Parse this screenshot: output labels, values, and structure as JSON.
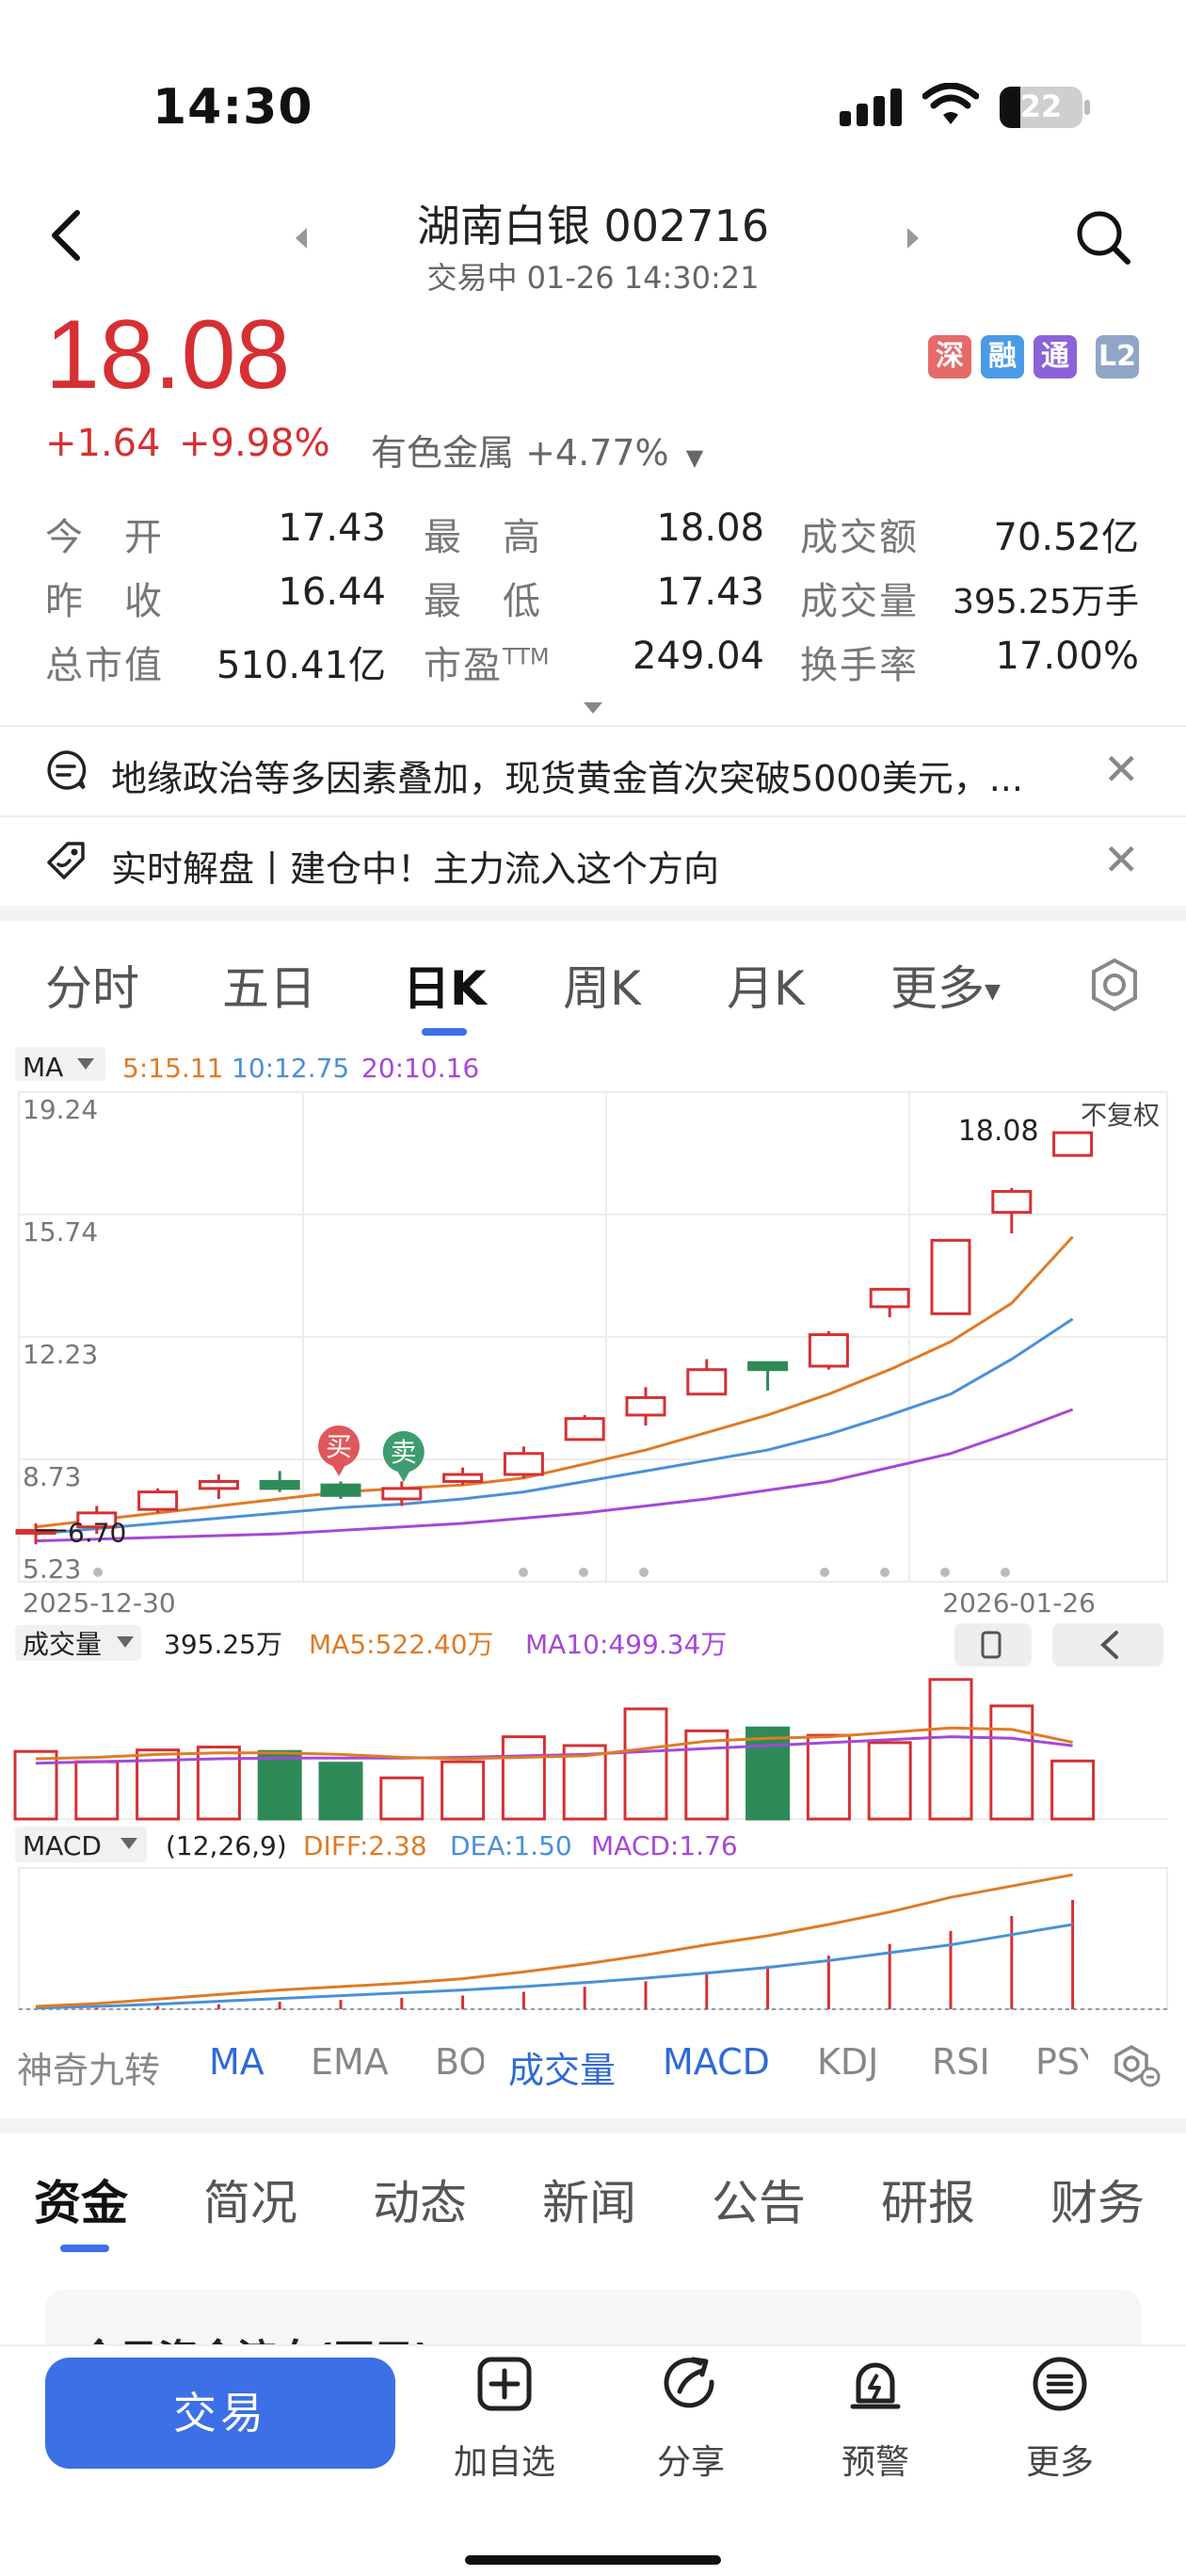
{
  "status": {
    "time": "14:30",
    "battery": "22"
  },
  "header": {
    "title": "湖南白银 002716",
    "subtitle": "交易中 01-26 14:30:21"
  },
  "price": {
    "current": "18.08",
    "change": "+1.64",
    "change_pct": "+9.98%",
    "sector": "有色金属 +4.77%"
  },
  "badges": [
    {
      "label": "深",
      "color": "#e66a6a"
    },
    {
      "label": "融",
      "color": "#4a9be6"
    },
    {
      "label": "通",
      "color": "#8a63d9"
    },
    {
      "label": "L2",
      "color": "#8fa6c7"
    }
  ],
  "stats": {
    "open_label": "今　开",
    "open": "17.43",
    "high_label": "最　高",
    "high": "18.08",
    "amount_label": "成交额",
    "amount": "70.52亿",
    "prev_label": "昨　收",
    "prev": "16.44",
    "low_label": "最　低",
    "low": "17.43",
    "volume_label": "成交量",
    "volume": "395.25万手",
    "mcap_label": "总市值",
    "mcap": "510.41亿",
    "pe_label": "市盈",
    "pe_sup": "TTM",
    "pe": "249.04",
    "turnover_label": "换手率",
    "turnover": "17.00%"
  },
  "news": [
    {
      "text": "地缘政治等多因素叠加，现货黄金首次突破5000美元，..."
    },
    {
      "text": "实时解盘丨建仓中！主力流入这个方向"
    }
  ],
  "chart_tabs": [
    "分时",
    "五日",
    "日K",
    "周K",
    "月K",
    "更多"
  ],
  "chart_tab_active": "日K",
  "ma_legend": {
    "label": "MA",
    "ma5": "5:15.11",
    "ma10": "10:12.75",
    "ma20": "20:10.16"
  },
  "price_axis": [
    "19.24",
    "15.74",
    "12.23",
    "8.73",
    "5.23"
  ],
  "price_axis_values": [
    19.24,
    15.74,
    12.23,
    8.73,
    5.23
  ],
  "date_axis": {
    "start": "2025-12-30",
    "end": "2026-01-26"
  },
  "high_label": "18.08",
  "low_label": "6.70",
  "no_adjust_label": "不复权",
  "buy_label": "买",
  "sell_label": "卖",
  "volume_legend": {
    "label": "成交量",
    "value": "395.25万",
    "ma5": "MA5:522.40万",
    "ma10": "MA10:499.34万"
  },
  "macd_legend": {
    "label": "MACD",
    "params": "(12,26,9)",
    "diff": "DIFF:2.38",
    "dea": "DEA:1.50",
    "macd": "MACD:1.76"
  },
  "chart_data": {
    "type": "candlestick",
    "ylim": [
      5.23,
      19.24
    ],
    "candles": [
      {
        "o": 6.7,
        "c": 6.7,
        "h": 6.9,
        "l": 6.3
      },
      {
        "o": 6.8,
        "c": 7.2,
        "h": 7.4,
        "l": 6.6
      },
      {
        "o": 7.3,
        "c": 7.8,
        "h": 7.9,
        "l": 7.2
      },
      {
        "o": 7.9,
        "c": 8.1,
        "h": 8.3,
        "l": 7.6
      },
      {
        "o": 8.1,
        "c": 7.9,
        "h": 8.4,
        "l": 7.8
      },
      {
        "o": 8.0,
        "c": 7.7,
        "h": 8.1,
        "l": 7.6
      },
      {
        "o": 7.6,
        "c": 7.9,
        "h": 8.1,
        "l": 7.4
      },
      {
        "o": 8.1,
        "c": 8.3,
        "h": 8.5,
        "l": 8.0
      },
      {
        "o": 8.3,
        "c": 8.9,
        "h": 9.1,
        "l": 8.2
      },
      {
        "o": 9.3,
        "c": 9.9,
        "h": 10.0,
        "l": 9.3
      },
      {
        "o": 10.0,
        "c": 10.5,
        "h": 10.8,
        "l": 9.7
      },
      {
        "o": 10.6,
        "c": 11.3,
        "h": 11.6,
        "l": 10.6
      },
      {
        "o": 11.5,
        "c": 11.3,
        "h": 11.5,
        "l": 10.7
      },
      {
        "o": 11.4,
        "c": 12.3,
        "h": 12.4,
        "l": 11.3
      },
      {
        "o": 13.1,
        "c": 13.6,
        "h": 13.6,
        "l": 12.8
      },
      {
        "o": 12.9,
        "c": 15.0,
        "h": 15.0,
        "l": 12.9
      },
      {
        "o": 15.8,
        "c": 16.4,
        "h": 16.5,
        "l": 15.2
      },
      {
        "o": 17.43,
        "c": 18.08,
        "h": 18.08,
        "l": 17.43
      }
    ],
    "ma5": [
      6.8,
      7.0,
      7.2,
      7.4,
      7.6,
      7.8,
      7.9,
      8.0,
      8.2,
      8.6,
      9.0,
      9.5,
      10.0,
      10.6,
      11.3,
      12.1,
      13.2,
      15.1
    ],
    "ma10": [
      6.6,
      6.75,
      6.9,
      7.05,
      7.2,
      7.35,
      7.45,
      7.6,
      7.8,
      8.1,
      8.4,
      8.7,
      9.0,
      9.45,
      10.0,
      10.6,
      11.6,
      12.75
    ],
    "ma20": [
      6.4,
      6.45,
      6.5,
      6.55,
      6.6,
      6.7,
      6.8,
      6.9,
      7.05,
      7.2,
      7.4,
      7.6,
      7.85,
      8.1,
      8.5,
      8.9,
      9.5,
      10.16
    ],
    "volume": [
      460,
      390,
      470,
      490,
      460,
      380,
      280,
      390,
      560,
      500,
      750,
      600,
      620,
      570,
      520,
      950,
      770,
      395.25
    ],
    "volume_ma5": [
      410,
      420,
      440,
      450,
      450,
      440,
      420,
      410,
      420,
      430,
      480,
      530,
      550,
      560,
      590,
      620,
      610,
      522.4
    ],
    "volume_ma10": [
      380,
      390,
      400,
      410,
      415,
      415,
      415,
      420,
      430,
      440,
      460,
      480,
      500,
      520,
      540,
      560,
      550,
      499.34
    ],
    "macd": [
      0.0,
      0.02,
      0.05,
      0.08,
      0.12,
      0.15,
      0.18,
      0.22,
      0.28,
      0.36,
      0.45,
      0.56,
      0.7,
      0.86,
      1.05,
      1.26,
      1.5,
      1.76
    ],
    "diff": [
      0.05,
      0.1,
      0.18,
      0.26,
      0.34,
      0.4,
      0.46,
      0.54,
      0.66,
      0.8,
      0.96,
      1.14,
      1.3,
      1.5,
      1.72,
      1.98,
      2.18,
      2.38
    ],
    "dea": [
      0.02,
      0.05,
      0.09,
      0.14,
      0.19,
      0.24,
      0.29,
      0.34,
      0.4,
      0.47,
      0.55,
      0.64,
      0.74,
      0.86,
      1.0,
      1.14,
      1.32,
      1.5
    ]
  },
  "indicators": [
    "神奇九转",
    "MA",
    "EMA",
    "BOLL",
    "成交量",
    "MACD",
    "KDJ",
    "RSI",
    "PSY"
  ],
  "indicators_active": [
    "MA",
    "成交量",
    "MACD"
  ],
  "bottom_tabs": [
    "资金",
    "简况",
    "动态",
    "新闻",
    "公告",
    "研报",
    "财务"
  ],
  "peek_title": "今日资金流向(万元)",
  "bottom_nav": {
    "trade": "交易",
    "watch": "加自选",
    "share": "分享",
    "alert": "预警",
    "more": "更多"
  }
}
